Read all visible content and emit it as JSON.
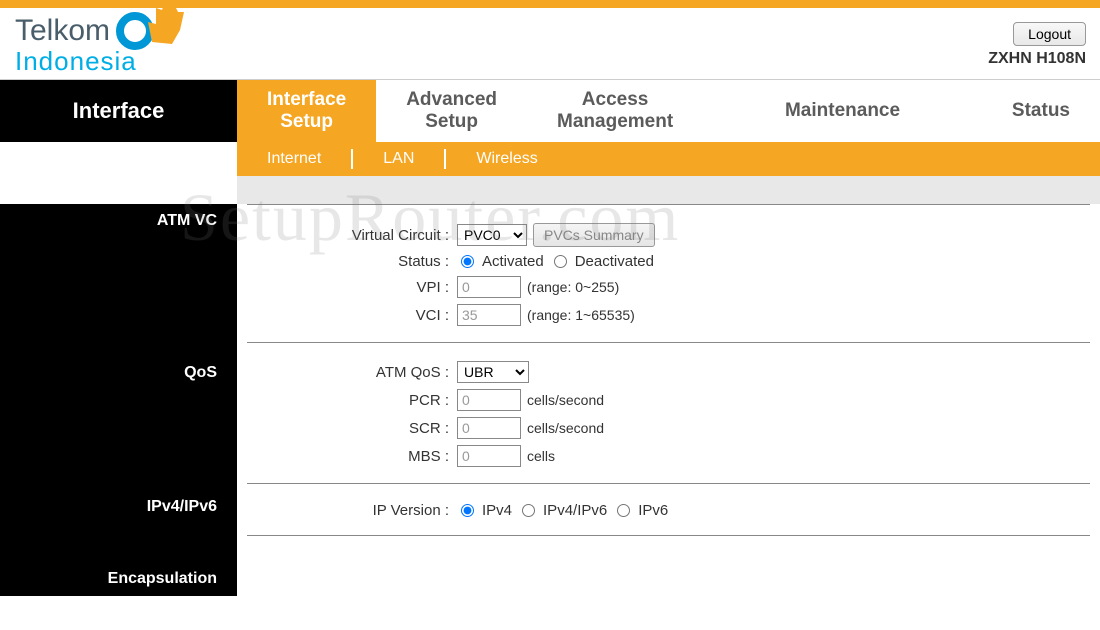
{
  "brand": {
    "name1": "Telkom",
    "name2": "Indonesia"
  },
  "header": {
    "logout": "Logout",
    "model": "ZXHN H108N"
  },
  "nav": {
    "current": "Interface",
    "tabs": [
      {
        "line1": "Interface",
        "line2": "Setup",
        "active": true
      },
      {
        "line1": "Advanced",
        "line2": "Setup",
        "active": false
      },
      {
        "line1": "Access",
        "line2": "Management",
        "active": false
      },
      {
        "line1": "Maintenance",
        "line2": "",
        "active": false
      },
      {
        "line1": "Status",
        "line2": "",
        "active": false
      }
    ],
    "subnav": [
      "Internet",
      "LAN",
      "Wireless"
    ]
  },
  "sections": {
    "atm_vc": "ATM VC",
    "qos": "QoS",
    "ipv": "IPv4/IPv6",
    "encap": "Encapsulation"
  },
  "labels": {
    "virtual_circuit": "Virtual Circuit :",
    "status": "Status :",
    "vpi": "VPI :",
    "vci": "VCI :",
    "atm_qos": "ATM QoS :",
    "pcr": "PCR :",
    "scr": "SCR :",
    "mbs": "MBS :",
    "ip_version": "IP Version :"
  },
  "values": {
    "pvc": "PVC0",
    "pvcs_summary": "PVCs Summary",
    "status_activated": "Activated",
    "status_deactivated": "Deactivated",
    "vpi": "0",
    "vpi_range": "(range: 0~255)",
    "vci": "35",
    "vci_range": "(range: 1~65535)",
    "atm_qos": "UBR",
    "pcr": "0",
    "pcr_unit": "cells/second",
    "scr": "0",
    "scr_unit": "cells/second",
    "mbs": "0",
    "mbs_unit": "cells",
    "ipv4": "IPv4",
    "ipv4ipv6": "IPv4/IPv6",
    "ipv6": "IPv6"
  },
  "watermark": "SetupRouter.com"
}
